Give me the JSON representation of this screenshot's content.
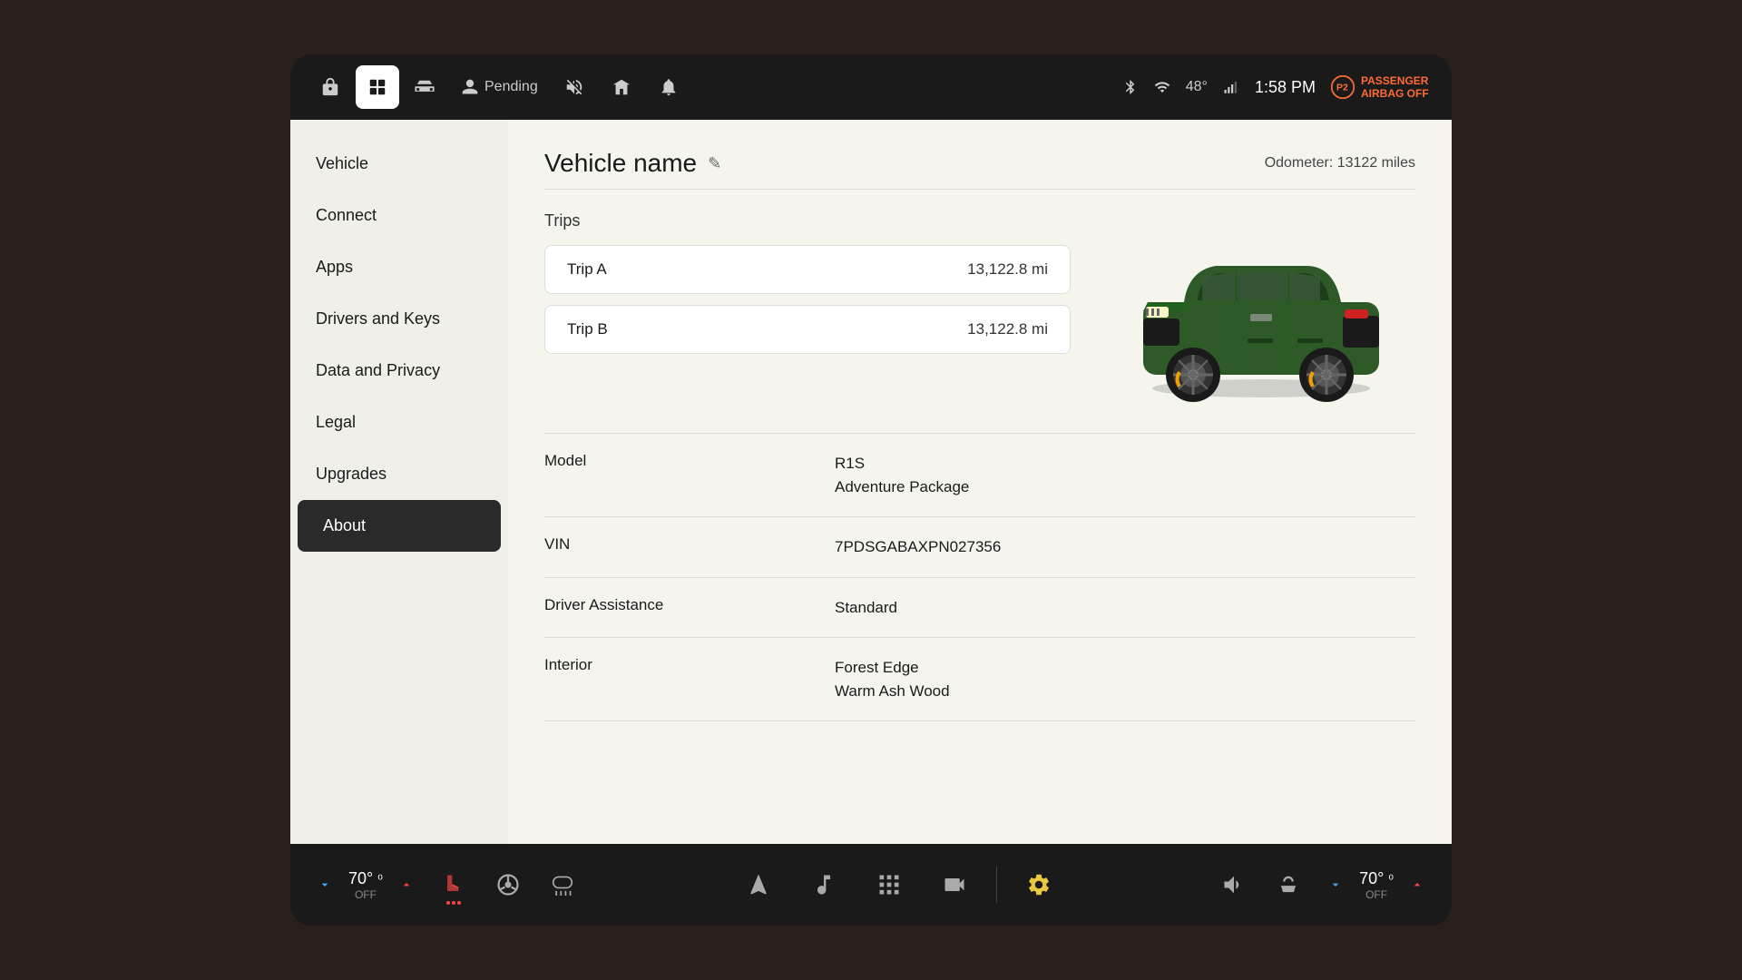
{
  "topbar": {
    "nav_items": [
      {
        "id": "lock",
        "icon": "🔒",
        "active": false
      },
      {
        "id": "home",
        "icon": "⊡",
        "active": true
      },
      {
        "id": "car",
        "icon": "🚗",
        "active": false
      },
      {
        "id": "person",
        "icon": "👤",
        "active": false
      },
      {
        "id": "pending",
        "label": "Pending",
        "active": false
      },
      {
        "id": "mute",
        "icon": "🔇",
        "active": false
      },
      {
        "id": "garage",
        "icon": "🏠",
        "active": false
      },
      {
        "id": "bell",
        "icon": "🔔",
        "active": false
      }
    ],
    "status": {
      "bluetooth": "⚙",
      "wifi": "wifi",
      "temperature": "48°",
      "signal": "signal",
      "time": "1:58 PM",
      "airbag_warning": "PASSENGER AIRBAG OFF",
      "airbag_icon": "⚠"
    }
  },
  "sidebar": {
    "items": [
      {
        "id": "vehicle",
        "label": "Vehicle",
        "active": false
      },
      {
        "id": "connect",
        "label": "Connect",
        "active": false
      },
      {
        "id": "apps",
        "label": "Apps",
        "active": false
      },
      {
        "id": "drivers-keys",
        "label": "Drivers and Keys",
        "active": false
      },
      {
        "id": "data-privacy",
        "label": "Data and Privacy",
        "active": false
      },
      {
        "id": "legal",
        "label": "Legal",
        "active": false
      },
      {
        "id": "upgrades",
        "label": "Upgrades",
        "active": false
      },
      {
        "id": "about",
        "label": "About",
        "active": true
      }
    ]
  },
  "content": {
    "vehicle_name": "Vehicle name",
    "edit_icon": "✎",
    "odometer_label": "Odometer: 13122 miles",
    "trips": {
      "title": "Trips",
      "items": [
        {
          "label": "Trip A",
          "value": "13,122.8 mi"
        },
        {
          "label": "Trip B",
          "value": "13,122.8 mi"
        }
      ]
    },
    "model": {
      "label": "Model",
      "value_line1": "R1S",
      "value_line2": "Adventure Package"
    },
    "vin": {
      "label": "VIN",
      "value": "7PDSGABAXPN027356"
    },
    "driver_assistance": {
      "label": "Driver Assistance",
      "value": "Standard"
    },
    "interior": {
      "label": "Interior",
      "value_line1": "Forest Edge",
      "value_line2": "Warm Ash Wood"
    }
  },
  "bottom_bar": {
    "left_temp": {
      "down_label": "▼",
      "up_label": "▲",
      "value": "70°",
      "unit": "℃",
      "status": "OFF",
      "mode": "heat"
    },
    "controls": [
      {
        "id": "seat-heat-left",
        "icon": "seat-heat",
        "has_dots": true
      },
      {
        "id": "steering-heat",
        "icon": "steering"
      },
      {
        "id": "defrost",
        "icon": "defrost"
      }
    ],
    "center": [
      {
        "id": "navigation",
        "icon": "nav"
      },
      {
        "id": "music",
        "icon": "music"
      },
      {
        "id": "apps-grid",
        "icon": "grid"
      },
      {
        "id": "camera",
        "icon": "camera"
      }
    ],
    "right_temp": {
      "down_label": "▼",
      "up_label": "▲",
      "value": "70°",
      "unit": "℃",
      "status": "OFF"
    },
    "settings": {
      "volume": "volume",
      "seat": "seat",
      "settings": "settings"
    }
  }
}
